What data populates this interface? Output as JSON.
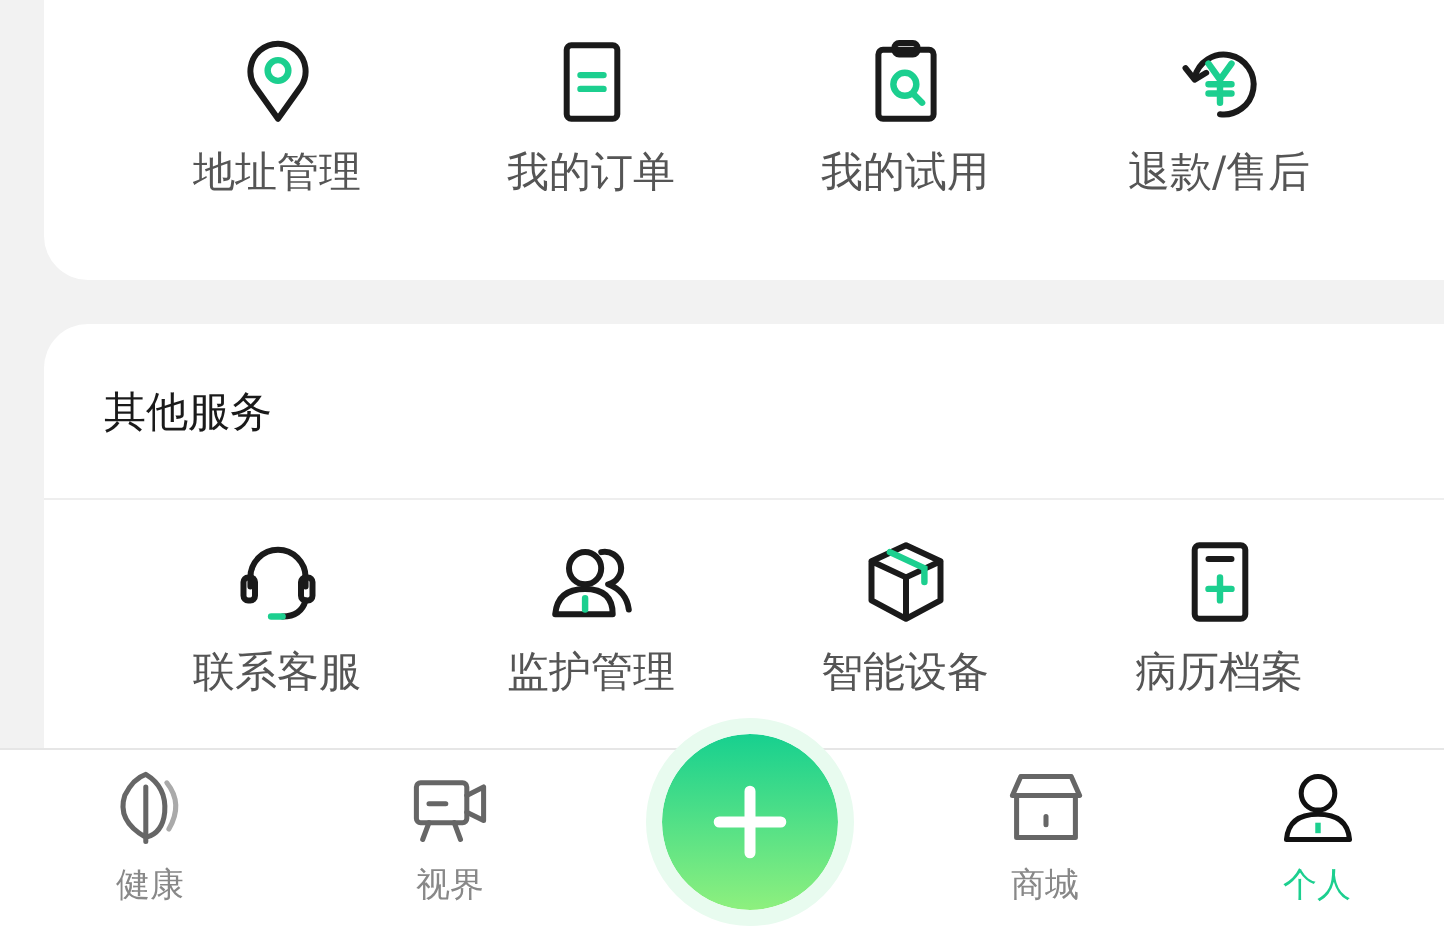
{
  "my_services": {
    "items": [
      {
        "kind": "pin",
        "label": "地址管理"
      },
      {
        "kind": "order",
        "label": "我的订单"
      },
      {
        "kind": "trial",
        "label": "我的试用"
      },
      {
        "kind": "refund",
        "label": "退款/售后"
      }
    ]
  },
  "other_services": {
    "title": "其他服务",
    "items": [
      {
        "kind": "headset",
        "label": "联系客服"
      },
      {
        "kind": "guardian",
        "label": "监护管理"
      },
      {
        "kind": "device",
        "label": "智能设备"
      },
      {
        "kind": "record",
        "label": "病历档案"
      }
    ]
  },
  "tab_bar": {
    "tabs": [
      {
        "kind": "leaf",
        "label": "健康",
        "selected": false
      },
      {
        "kind": "camera",
        "label": "视界",
        "selected": false
      },
      {
        "kind": "add"
      },
      {
        "kind": "store",
        "label": "商城",
        "selected": false
      },
      {
        "kind": "person",
        "label": "个人",
        "selected": true
      }
    ]
  }
}
